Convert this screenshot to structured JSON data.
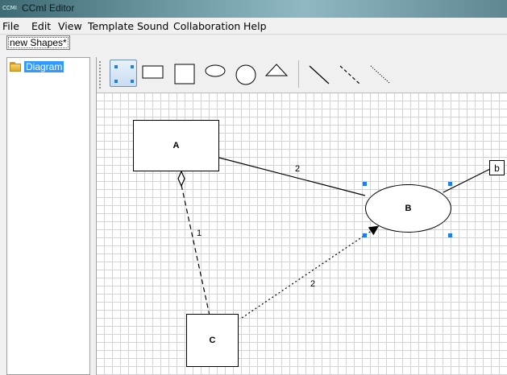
{
  "window": {
    "title": "CCmI Editor",
    "app_icon_text": "CCMI"
  },
  "menu": {
    "items": [
      "File",
      "Edit",
      "View",
      "Template",
      "Sound",
      "Collaboration",
      "Help"
    ]
  },
  "document_tab": {
    "label": "new Shapes*"
  },
  "tree": {
    "root_label": "Diagram",
    "root_icon": "folder-icon"
  },
  "toolbar": {
    "tools": [
      "select-tool",
      "rectangle-tool",
      "square-tool",
      "ellipse-tool",
      "circle-tool",
      "triangle-tool",
      "solid-line-tool",
      "dashed-line-tool",
      "dotted-line-tool"
    ],
    "selected_tool": "select-tool"
  },
  "diagram": {
    "nodes": [
      {
        "id": "A",
        "label": "A",
        "shape": "rectangle"
      },
      {
        "id": "B",
        "label": "B",
        "shape": "ellipse",
        "selected": true
      },
      {
        "id": "C",
        "label": "C",
        "shape": "square"
      },
      {
        "id": "b",
        "label": "b",
        "shape": "small-box"
      }
    ],
    "edges": [
      {
        "from": "A",
        "to": "B",
        "style": "solid",
        "label": "2"
      },
      {
        "from": "A",
        "to": "C",
        "style": "dashed",
        "label": "1",
        "end_marker": "diamond"
      },
      {
        "from": "C",
        "to": "B",
        "style": "dotted",
        "label": "2",
        "end_marker": "arrow"
      },
      {
        "from": "B",
        "to": "b",
        "style": "solid",
        "label": ""
      }
    ]
  },
  "colors": {
    "grid": "#e8c8d4",
    "selection_handle": "#1e7fe0",
    "tree_selection": "#3399ff"
  }
}
